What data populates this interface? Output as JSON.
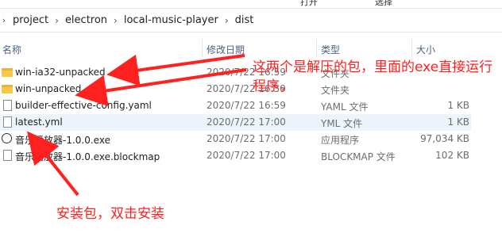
{
  "ribbon": {
    "left_label": "",
    "mid_label": "打开",
    "right_label": "选择"
  },
  "breadcrumb": [
    "project",
    "electron",
    "local-music-player",
    "dist"
  ],
  "columns": {
    "name": "名称",
    "date": "修改日期",
    "type": "类型",
    "size": "大小"
  },
  "files": [
    {
      "name": "win-ia32-unpacked",
      "date": "2020/7/22 16:59",
      "type": "文件夹",
      "size": "",
      "icon": "folder-icon"
    },
    {
      "name": "win-unpacked",
      "date": "2020/7/22 16:59",
      "type": "文件夹",
      "size": "",
      "icon": "folder-icon"
    },
    {
      "name": "builder-effective-config.yaml",
      "date": "2020/7/22 16:59",
      "type": "YAML 文件",
      "size": "1 KB",
      "icon": "file-icon"
    },
    {
      "name": "latest.yml",
      "date": "2020/7/22 17:00",
      "type": "YML 文件",
      "size": "1 KB",
      "icon": "file-icon"
    },
    {
      "name": "音乐播放器-1.0.0.exe",
      "date": "2020/7/22 17:00",
      "type": "应用程序",
      "size": "97,034 KB",
      "icon": "music-exe-icon"
    },
    {
      "name": "音乐播放器-1.0.0.exe.blockmap",
      "date": "2020/7/22 17:00",
      "type": "BLOCKMAP 文件",
      "size": "102 KB",
      "icon": "file-icon"
    }
  ],
  "annotations": {
    "top": "这两个是解压的包，里面的exe直接运行程序。",
    "bottom": "安装包，双击安装"
  },
  "colors": {
    "annotation": "#ff2020",
    "header_text": "#4d6082",
    "folder": "#f6c949"
  }
}
